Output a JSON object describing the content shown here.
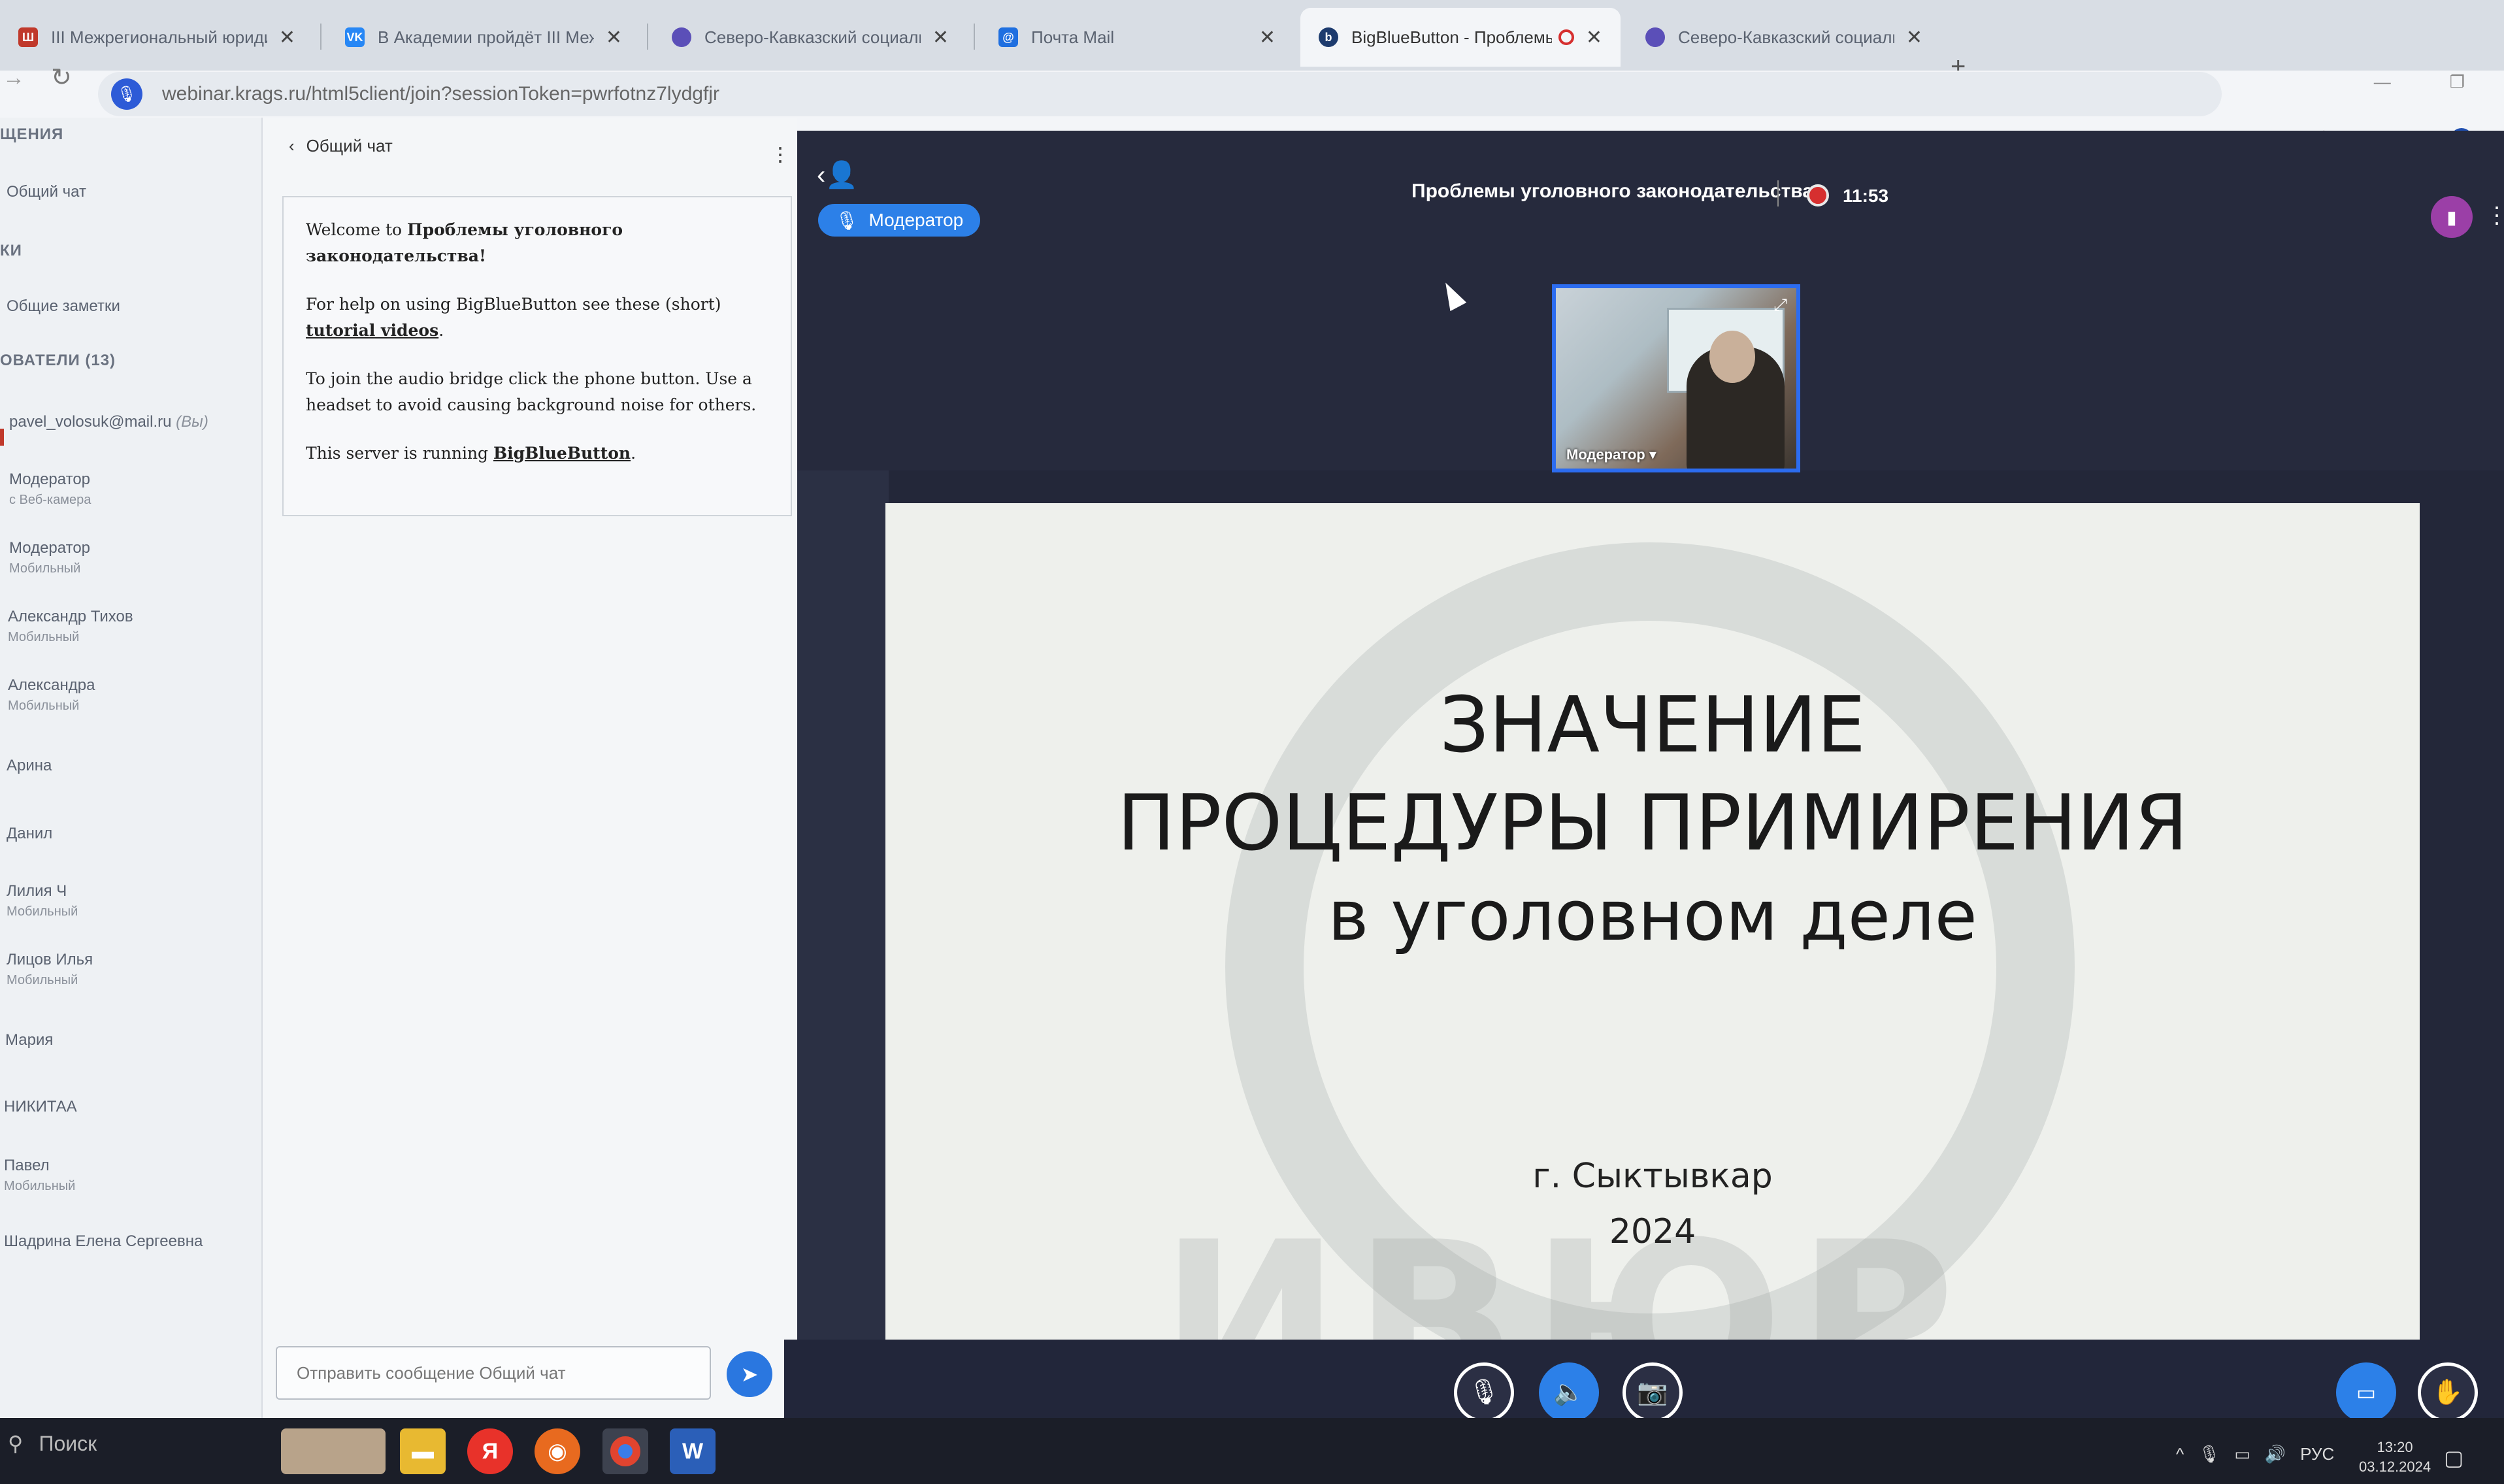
{
  "browser": {
    "tabs": [
      {
        "title": "III Межрегиональный юриди...",
        "active": false
      },
      {
        "title": "В Академии пройдёт III Межр...",
        "active": false
      },
      {
        "title": "Северо-Кавказский социальн...",
        "active": false
      },
      {
        "title": "Почта Mail",
        "active": false
      },
      {
        "title": "BigBlueButton - Проблемы...",
        "active": true
      },
      {
        "title": "Северо-Кавказский социальн...",
        "active": false
      }
    ],
    "new_tab": "+",
    "url": "webinar.krags.ru/html5client/join?sessionToken=pwrfotnz7lydgfjr"
  },
  "userlist": {
    "section_messages": "ЩЕНИЯ",
    "public_chat": "Общий чат",
    "section_notes": "КИ",
    "shared_notes": "Общие заметки",
    "section_users": "ОВАТЕЛИ (13)",
    "users": [
      {
        "name": "pavel_volosuk@mail.ru",
        "suffix": "(Вы)",
        "sub": ""
      },
      {
        "name": "Модератор",
        "sub": "с Веб-камера"
      },
      {
        "name": "Модератор",
        "sub": "Мобильный"
      },
      {
        "name": "Александр Тихов",
        "sub": "Мобильный"
      },
      {
        "name": "Александра",
        "sub": "Мобильный"
      },
      {
        "name": "Арина",
        "sub": ""
      },
      {
        "name": "Данил",
        "sub": ""
      },
      {
        "name": "Лилия Ч",
        "sub": "Мобильный"
      },
      {
        "name": "Лицов Илья",
        "sub": "Мобильный"
      },
      {
        "name": "Мария",
        "sub": ""
      },
      {
        "name": "НИКИТАА",
        "sub": ""
      },
      {
        "name": "Павел",
        "sub": "Мобильный"
      },
      {
        "name": "Шадрина Елена Сергеевна",
        "sub": ""
      }
    ]
  },
  "chat": {
    "title": "Общий чат",
    "welcome_prefix": "Welcome to ",
    "welcome_room": "Проблемы уголовного законодательства",
    "welcome_suffix": "!",
    "help_prefix": "For help on using BigBlueButton see these (short) ",
    "help_link": "tutorial videos",
    "help_suffix": ".",
    "audio_help": "To join the audio bridge click the phone button. Use a headset to avoid causing background noise for others.",
    "server_prefix": "This server is running ",
    "server_link": "BigBlueButton",
    "server_suffix": ".",
    "input_placeholder": "Отправить сообщение Общий чат"
  },
  "meeting": {
    "moderator_badge": "Модератор",
    "title": "Проблемы уголовного законодательства",
    "rec_time": "11:53",
    "webcam_label": "Модератор"
  },
  "slide": {
    "line1": "ЗНАЧЕНИЕ",
    "line2": "ПРОЦЕДУРЫ ПРИМИРЕНИЯ",
    "line3": "в уголовном деле",
    "city": "г. Сыктывкар",
    "year": "2024",
    "watermark": "ИВЮР"
  },
  "taskbar": {
    "search": "Поиск",
    "lang": "РУС",
    "time": "13:20",
    "date": "03.12.2024"
  }
}
